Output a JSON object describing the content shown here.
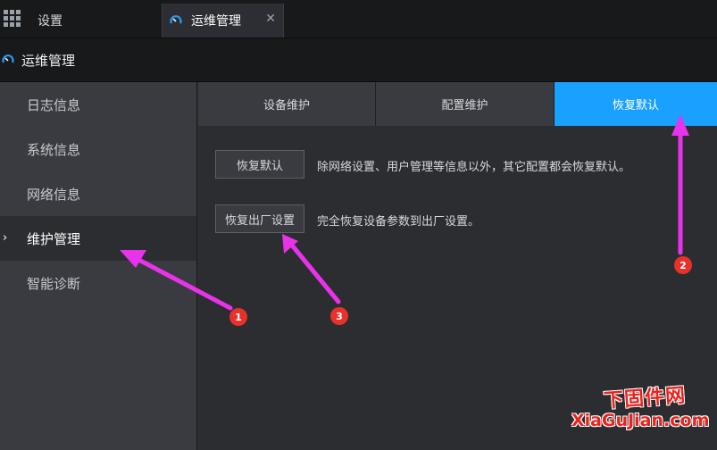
{
  "topbar": {
    "apps_icon": "apps-grid-icon",
    "tabs": [
      {
        "label": "设置"
      },
      {
        "label": "运维管理",
        "icon": "gauge-icon",
        "close": "✕"
      }
    ]
  },
  "header": {
    "icon": "gauge-icon",
    "title": "运维管理"
  },
  "sidebar": {
    "items": [
      {
        "label": "日志信息"
      },
      {
        "label": "系统信息"
      },
      {
        "label": "网络信息"
      },
      {
        "label": "维护管理",
        "active": true,
        "caret": "›"
      },
      {
        "label": "智能诊断"
      }
    ]
  },
  "subtabs": [
    {
      "label": "设备维护"
    },
    {
      "label": "配置维护"
    },
    {
      "label": "恢复默认",
      "active": true
    }
  ],
  "content": {
    "restore_default": {
      "button": "恢复默认",
      "description": "除网络设置、用户管理等信息以外，其它配置都会恢复默认。"
    },
    "factory_reset": {
      "button": "恢复出厂设置",
      "description": "完全恢复设备参数到出厂设置。"
    }
  },
  "annotations": {
    "badges": [
      "1",
      "2",
      "3"
    ],
    "arrow_color": "#e933ea",
    "badge_color": "#e8312a"
  },
  "watermark": {
    "line1": "下固件网",
    "line2": "XiaGuJian.com"
  },
  "colors": {
    "accent": "#1aa0ff",
    "topbar_bg": "#18191b",
    "sidebar_bg": "#393b40",
    "content_bg": "#2b2d31"
  }
}
